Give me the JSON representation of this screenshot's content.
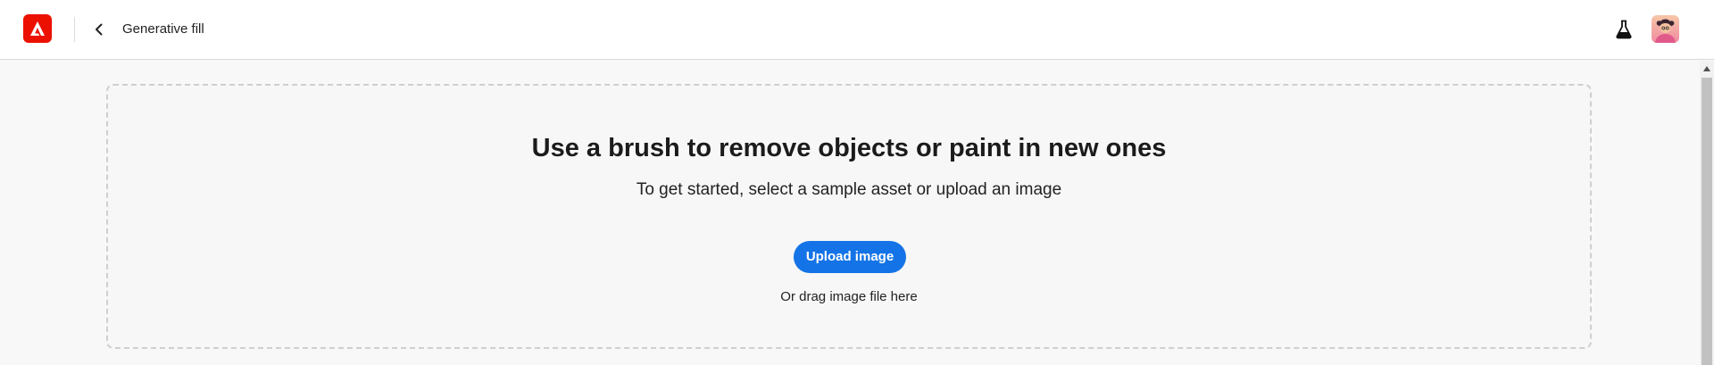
{
  "header": {
    "app_logo": "adobe-express-logo",
    "back_icon": "chevron-left-icon",
    "title": "Generative fill",
    "labs_icon": "flask-icon",
    "avatar": "user-avatar"
  },
  "dropzone": {
    "headline": "Use a brush to remove objects or paint in new ones",
    "subhead": "To get started, select a sample asset or upload an image",
    "upload_label": "Upload image",
    "drag_hint": "Or drag image file here"
  },
  "colors": {
    "brand_red": "#eb1000",
    "accent_blue": "#1473e6",
    "background": "#f8f8f8"
  }
}
